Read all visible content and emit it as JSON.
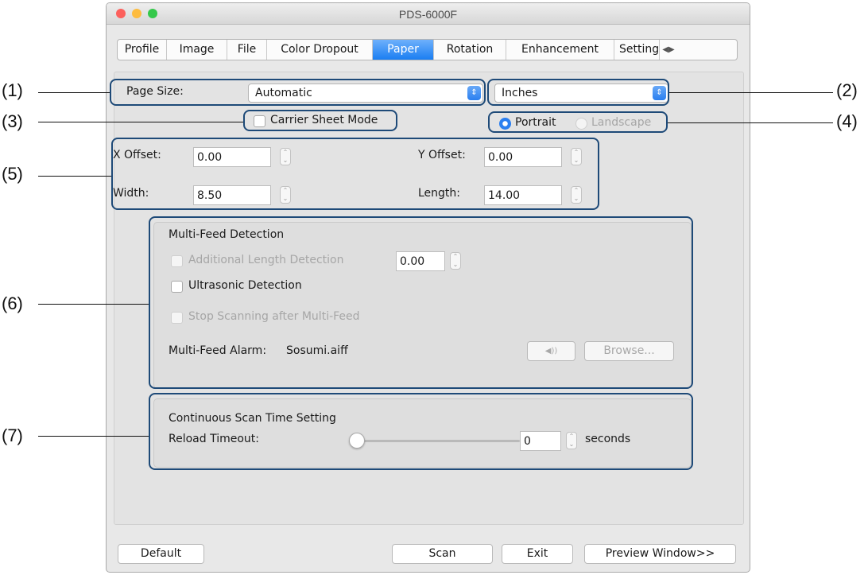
{
  "window": {
    "title": "PDS-6000F"
  },
  "tabs": [
    {
      "label": "Profile"
    },
    {
      "label": "Image"
    },
    {
      "label": "File"
    },
    {
      "label": "Color Dropout"
    },
    {
      "label": "Paper"
    },
    {
      "label": "Rotation"
    },
    {
      "label": "Enhancement"
    },
    {
      "label": "Setting"
    }
  ],
  "active_tab": "Paper",
  "paper": {
    "page_size_label": "Page Size:",
    "page_size_value": "Automatic",
    "unit_value": "Inches",
    "carrier_sheet_label": "Carrier Sheet Mode",
    "portrait_label": "Portrait",
    "landscape_label": "Landscape",
    "x_offset_label": "X Offset:",
    "x_offset_value": "0.00",
    "y_offset_label": "Y Offset:",
    "y_offset_value": "0.00",
    "width_label": "Width:",
    "width_value": "8.50",
    "length_label": "Length:",
    "length_value": "14.00"
  },
  "multifeed": {
    "title": "Multi-Feed Detection",
    "additional_length_label": "Additional Length Detection",
    "additional_length_value": "0.00",
    "ultrasonic_label": "Ultrasonic Detection",
    "stop_scanning_label": "Stop Scanning after Multi-Feed",
    "alarm_label": "Multi-Feed Alarm:",
    "alarm_value": "Sosumi.aiff",
    "speaker_glyph": "◀))",
    "browse_label": "Browse..."
  },
  "continuous": {
    "title": "Continuous Scan Time Setting",
    "reload_label": "Reload Timeout:",
    "reload_value": "0",
    "slider_fraction": 0,
    "seconds_label": "seconds"
  },
  "buttons": {
    "default": "Default",
    "scan": "Scan",
    "exit": "Exit",
    "preview": "Preview Window>>"
  },
  "callouts": {
    "c1": "(1)",
    "c2": "(2)",
    "c3": "(3)",
    "c4": "(4)",
    "c5": "(5)",
    "c6": "(6)",
    "c7": "(7)"
  },
  "colors": {
    "accent": "#1a7ef2",
    "annotation": "#1e4a78",
    "close": "#fc605c",
    "minimize": "#fdbc40",
    "zoom": "#34c84a"
  },
  "icons": {
    "popup_arrow": "chevron-updown-icon",
    "stepper": "stepper-icon",
    "speaker": "speaker-icon",
    "tab_scroll": "tab-scroll-icon"
  }
}
